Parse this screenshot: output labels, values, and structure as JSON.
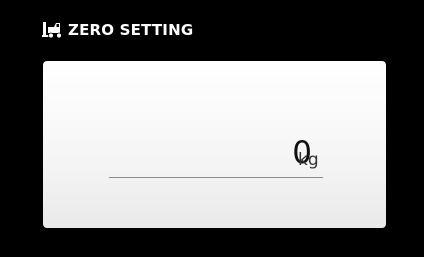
{
  "header": {
    "icon": "forklift-icon",
    "title": "ZERO SETTING"
  },
  "display": {
    "value": "0",
    "unit": "kg"
  },
  "colors": {
    "background": "#000000",
    "panel": "#f4f4f4",
    "text": "#111111"
  }
}
